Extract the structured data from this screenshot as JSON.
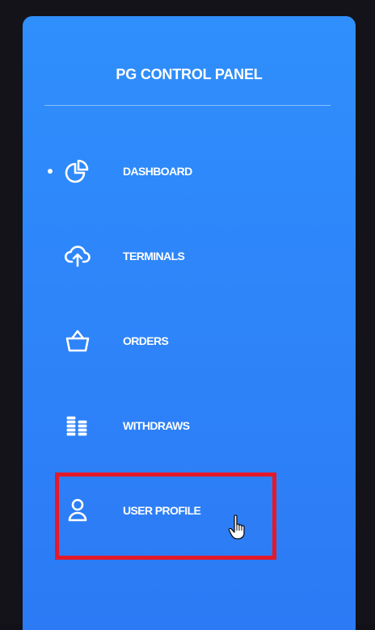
{
  "panel": {
    "title": "PG CONTROL PANEL"
  },
  "nav": {
    "items": [
      {
        "label": "DASHBOARD",
        "icon": "pie-chart-icon",
        "active": true
      },
      {
        "label": "TERMINALS",
        "icon": "cloud-upload-icon",
        "active": false
      },
      {
        "label": "ORDERS",
        "icon": "basket-icon",
        "active": false
      },
      {
        "label": "WITHDRAWS",
        "icon": "coins-icon",
        "active": false
      },
      {
        "label": "USER PROFILE",
        "icon": "user-icon",
        "active": false
      }
    ]
  },
  "colors": {
    "sidebar_top": "#2f8ffb",
    "sidebar_bottom": "#2c7af5",
    "highlight": "#e3192a",
    "background": "#131319"
  }
}
